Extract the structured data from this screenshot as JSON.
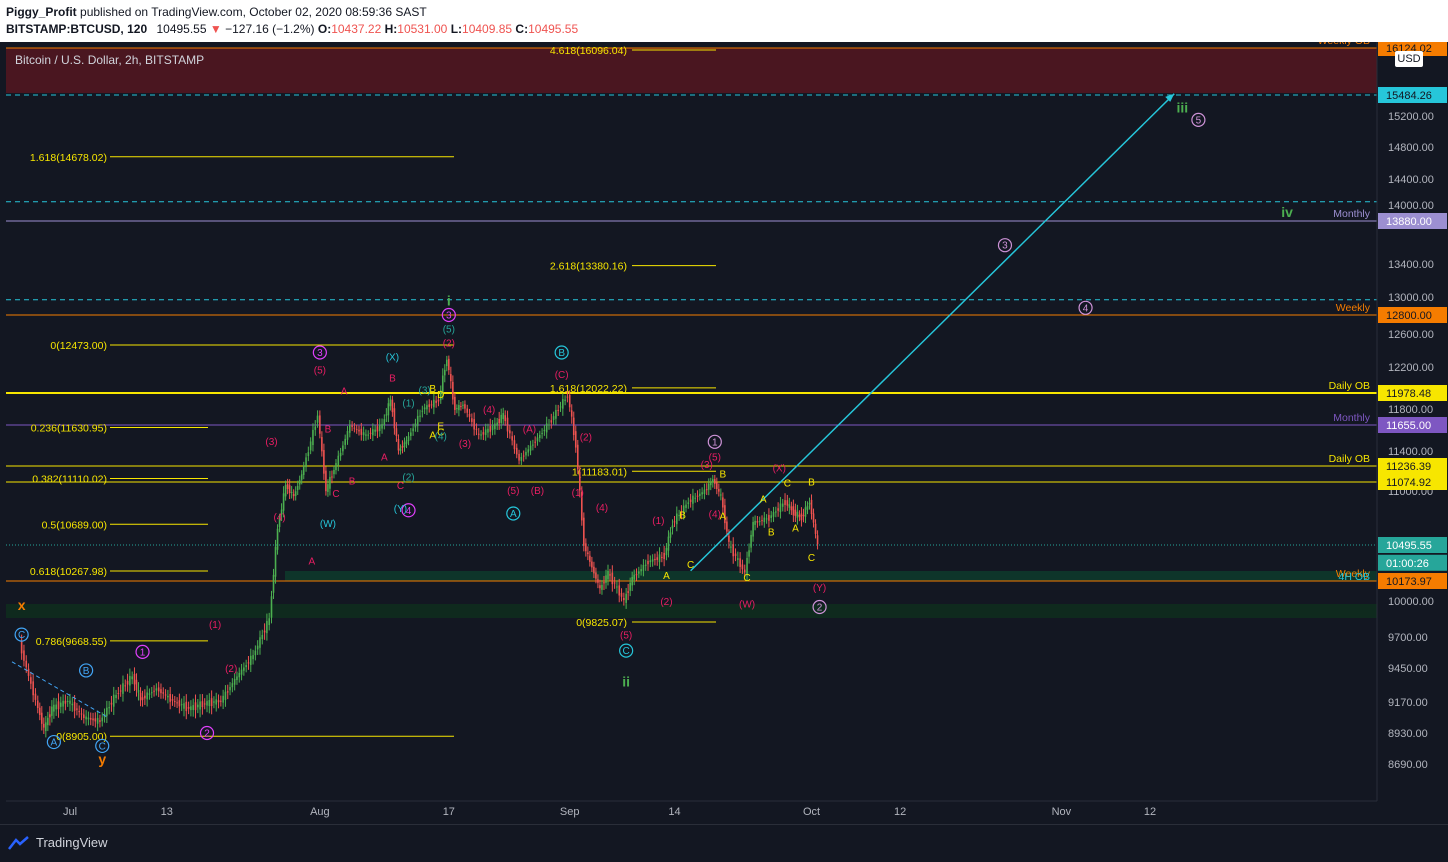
{
  "header": {
    "author": "Piggy_Profit",
    "published_text": "published on TradingView.com, October 02, 2020 08:59:36 SAST",
    "symbol": "BITSTAMP:BTCUSD, 120",
    "last": "10495.55",
    "change": "−127.16 (−1.2%)",
    "o_label": "O:",
    "o": "10437.22",
    "h_label": "H:",
    "h": "10531.00",
    "l_label": "L:",
    "l": "10409.85",
    "c_label": "C:",
    "c": "10495.55"
  },
  "chart_title": "Bitcoin / U.S. Dollar, 2h, BITSTAMP",
  "currency_badge": "USD",
  "footer": {
    "brand": "TradingView"
  },
  "colors": {
    "background": "#131722",
    "fib_yellow": "#f7e600",
    "cyan": "#26c6da",
    "orange": "#f57c00",
    "purple": "#7e57c2",
    "magenta": "#e91e63",
    "green": "#4caf50",
    "lavender": "#ce93d8",
    "price_up": "#26a69a",
    "price_down": "#ef5350"
  },
  "chart_data": {
    "type": "candlestick",
    "symbol": "BITSTAMP:BTCUSD",
    "interval": "2h",
    "ylim": [
      8500,
      16200
    ],
    "y_ticks": [
      15200,
      14800,
      14400,
      14000,
      13400,
      13000,
      12600,
      12200,
      11800,
      11400,
      11000,
      10000,
      9700,
      9450,
      9170,
      8930,
      8690
    ],
    "y_tick_labels": [
      "15200.00",
      "14800.00",
      "14400.00",
      "14000.00",
      "13400.00",
      "13000.00",
      "12600.00",
      "12200.00",
      "11800.00",
      "11400.00",
      "11000.00",
      "10000.00",
      "9700.00",
      "9450.00",
      "9170.00",
      "8930.00",
      "8690.00"
    ],
    "x_tick_labels": [
      "Jul",
      "13",
      "Aug",
      "17",
      "Sep",
      "14",
      "Oct",
      "12",
      "Nov",
      "12"
    ],
    "x_tick_dates": [
      "2020-07-01",
      "2020-07-13",
      "2020-08-01",
      "2020-08-17",
      "2020-09-01",
      "2020-09-14",
      "2020-10-01",
      "2020-10-12",
      "2020-11-01",
      "2020-11-12"
    ],
    "price_path": [
      [
        "2020-06-25",
        9650
      ],
      [
        "2020-06-27",
        9180
      ],
      [
        "2020-06-28",
        8960
      ],
      [
        "2020-06-29",
        9120
      ],
      [
        "2020-07-01",
        9180
      ],
      [
        "2020-07-03",
        9050
      ],
      [
        "2020-07-05",
        9020
      ],
      [
        "2020-07-07",
        9230
      ],
      [
        "2020-07-09",
        9380
      ],
      [
        "2020-07-10",
        9190
      ],
      [
        "2020-07-12",
        9280
      ],
      [
        "2020-07-14",
        9180
      ],
      [
        "2020-07-16",
        9120
      ],
      [
        "2020-07-18",
        9160
      ],
      [
        "2020-07-20",
        9180
      ],
      [
        "2020-07-22",
        9380
      ],
      [
        "2020-07-24",
        9550
      ],
      [
        "2020-07-26",
        9850
      ],
      [
        "2020-07-27",
        10650
      ],
      [
        "2020-07-28",
        11050
      ],
      [
        "2020-07-29",
        10950
      ],
      [
        "2020-07-30",
        11150
      ],
      [
        "2020-08-01",
        11750
      ],
      [
        "2020-08-02",
        11000
      ],
      [
        "2020-08-03",
        11200
      ],
      [
        "2020-08-05",
        11650
      ],
      [
        "2020-08-07",
        11550
      ],
      [
        "2020-08-09",
        11650
      ],
      [
        "2020-08-10",
        11900
      ],
      [
        "2020-08-11",
        11400
      ],
      [
        "2020-08-12",
        11500
      ],
      [
        "2020-08-14",
        11800
      ],
      [
        "2020-08-16",
        11900
      ],
      [
        "2020-08-17",
        12300
      ],
      [
        "2020-08-18",
        11800
      ],
      [
        "2020-08-19",
        11850
      ],
      [
        "2020-08-21",
        11550
      ],
      [
        "2020-08-23",
        11650
      ],
      [
        "2020-08-24",
        11750
      ],
      [
        "2020-08-26",
        11300
      ],
      [
        "2020-08-28",
        11500
      ],
      [
        "2020-08-30",
        11700
      ],
      [
        "2020-09-01",
        11950
      ],
      [
        "2020-09-02",
        11450
      ],
      [
        "2020-09-03",
        10500
      ],
      [
        "2020-09-04",
        10300
      ],
      [
        "2020-09-05",
        10100
      ],
      [
        "2020-09-06",
        10250
      ],
      [
        "2020-09-08",
        10000
      ],
      [
        "2020-09-09",
        10200
      ],
      [
        "2020-09-11",
        10350
      ],
      [
        "2020-09-13",
        10400
      ],
      [
        "2020-09-14",
        10700
      ],
      [
        "2020-09-16",
        10900
      ],
      [
        "2020-09-18",
        11000
      ],
      [
        "2020-09-19",
        11100
      ],
      [
        "2020-09-20",
        10950
      ],
      [
        "2020-09-21",
        10500
      ],
      [
        "2020-09-23",
        10250
      ],
      [
        "2020-09-24",
        10700
      ],
      [
        "2020-09-26",
        10750
      ],
      [
        "2020-09-28",
        10900
      ],
      [
        "2020-09-29",
        10800
      ],
      [
        "2020-09-30",
        10750
      ],
      [
        "2020-10-01",
        10900
      ],
      [
        "2020-10-02",
        10495
      ]
    ],
    "horizontal_levels": [
      {
        "price": 16124.02,
        "label": "Weekly OB",
        "color": "#f57c00"
      },
      {
        "price": 15484.26,
        "label": "",
        "color": "#26c6da"
      },
      {
        "price": 13880.0,
        "label": "Monthly",
        "color": "#9c8fd1"
      },
      {
        "price": 12800.0,
        "label": "Weekly",
        "color": "#f57c00"
      },
      {
        "price": 11978.48,
        "label": "Daily OB",
        "color": "#f7e600"
      },
      {
        "price": 11655.0,
        "label": "Monthly",
        "color": "#7e57c2"
      },
      {
        "price": 11236.39,
        "label": "Daily OB",
        "color": "#f7e600"
      },
      {
        "price": 11074.92,
        "label": "",
        "color": "#f7e600"
      },
      {
        "price": 10495.55,
        "label": "",
        "color": "#26a69a"
      },
      {
        "price": 10173.97,
        "label": "Weekly",
        "color": "#f57c00"
      }
    ],
    "price_axis_badges": [
      {
        "text": "16124.02",
        "price": 16124.02,
        "bg": "#f57c00",
        "fg": "#131722"
      },
      {
        "text": "15484.26",
        "price": 15484.26,
        "bg": "#26c6da",
        "fg": "#131722"
      },
      {
        "text": "13880.00",
        "price": 13880.0,
        "bg": "#9c8fd1",
        "fg": "#ffffff"
      },
      {
        "text": "12800.00",
        "price": 12800.0,
        "bg": "#f57c00",
        "fg": "#131722"
      },
      {
        "text": "11978.48",
        "price": 11978.48,
        "bg": "#f7e600",
        "fg": "#131722"
      },
      {
        "text": "11655.00",
        "price": 11655.0,
        "bg": "#7e57c2",
        "fg": "#ffffff"
      },
      {
        "text": "11236.39",
        "price": 11236.39,
        "bg": "#f7e600",
        "fg": "#131722"
      },
      {
        "text": "11074.92",
        "price": 11074.92,
        "bg": "#f7e600",
        "fg": "#131722"
      },
      {
        "text": "10495.55",
        "price": 10495.55,
        "bg": "#26a69a",
        "fg": "#ffffff"
      },
      {
        "text": "01:00:26",
        "price": 10340,
        "bg": "#26a69a",
        "fg": "#ffffff"
      },
      {
        "text": "10173.97",
        "price": 10173.97,
        "bg": "#f57c00",
        "fg": "#131722"
      }
    ],
    "extra_level_labels": [
      {
        "text": "4H OB",
        "price": 10200,
        "color": "#26c6da"
      }
    ],
    "fib_left": [
      {
        "label": "1.618(14678.02)",
        "price": 14678.02
      },
      {
        "label": "0(12473.00)",
        "price": 12473.0
      },
      {
        "label": "0.236(11630.95)",
        "price": 11630.95
      },
      {
        "label": "0.382(11110.02)",
        "price": 11110.02
      },
      {
        "label": "0.5(10689.00)",
        "price": 10689.0
      },
      {
        "label": "0.618(10267.98)",
        "price": 10267.98
      },
      {
        "label": "0.786(9668.55)",
        "price": 9668.55
      },
      {
        "label": "0(8905.00)",
        "price": 8905.0
      }
    ],
    "fib_right": [
      {
        "label": "4.618(16096.04)",
        "price": 16096.04
      },
      {
        "label": "2.618(13380.16)",
        "price": 13380.16
      },
      {
        "label": "1.618(12022.22)",
        "price": 12022.22
      },
      {
        "label": "1(11183.01)",
        "price": 11183.01
      },
      {
        "label": "0(9825.07)",
        "price": 9825.07
      }
    ],
    "projection": {
      "from": [
        "2020-09-16",
        10270
      ],
      "to": [
        "2020-11-15",
        15500
      ]
    },
    "wave_labels": [
      {
        "text": "i",
        "date": "2020-08-17",
        "price": 12950,
        "color": "#4caf50"
      },
      {
        "text": "ii",
        "date": "2020-09-08",
        "price": 9330,
        "color": "#4caf50"
      },
      {
        "text": "iii",
        "date": "2020-11-16",
        "price": 15300,
        "color": "#4caf50"
      },
      {
        "text": "iv",
        "date": "2020-11-29",
        "price": 13940,
        "color": "#4caf50"
      },
      {
        "text": "x",
        "date": "2020-06-25",
        "price": 9960,
        "color": "#f57c00"
      },
      {
        "text": "y",
        "date": "2020-07-05",
        "price": 8720,
        "color": "#f57c00"
      },
      {
        "text": "1",
        "date": "2020-09-19",
        "price": 11490,
        "color": "#ce93d8",
        "circled": true
      },
      {
        "text": "2",
        "date": "2020-10-02",
        "price": 9950,
        "color": "#ce93d8",
        "circled": true
      },
      {
        "text": "3",
        "date": "2020-10-25",
        "price": 13610,
        "color": "#ce93d8",
        "circled": true
      },
      {
        "text": "4",
        "date": "2020-11-04",
        "price": 12880,
        "color": "#ce93d8",
        "circled": true
      },
      {
        "text": "5",
        "date": "2020-11-18",
        "price": 15150,
        "color": "#ce93d8",
        "circled": true
      },
      {
        "text": "1",
        "date": "2020-07-10",
        "price": 9580,
        "color": "#e040fb",
        "circled": true
      },
      {
        "text": "2",
        "date": "2020-07-18",
        "price": 8930,
        "color": "#e040fb",
        "circled": true
      },
      {
        "text": "3",
        "date": "2020-08-01",
        "price": 12380,
        "color": "#e040fb",
        "circled": true
      },
      {
        "text": "4",
        "date": "2020-08-12",
        "price": 10820,
        "color": "#e040fb",
        "circled": true
      },
      {
        "text": "3",
        "date": "2020-08-17",
        "price": 12800,
        "color": "#e040fb",
        "circled": true
      },
      {
        "text": "A",
        "date": "2020-08-25",
        "price": 10790,
        "color": "#26c6da",
        "circled": true
      },
      {
        "text": "B",
        "date": "2020-08-31",
        "price": 12380,
        "color": "#26c6da",
        "circled": true
      },
      {
        "text": "C",
        "date": "2020-09-08",
        "price": 9590,
        "color": "#26c6da",
        "circled": true
      },
      {
        "text": "A",
        "date": "2020-06-29",
        "price": 8860,
        "color": "#42a5f5",
        "circled": true
      },
      {
        "text": "B",
        "date": "2020-07-03",
        "price": 9430,
        "color": "#42a5f5",
        "circled": true
      },
      {
        "text": "C",
        "date": "2020-07-05",
        "price": 8830,
        "color": "#42a5f5",
        "circled": true
      },
      {
        "text": "C",
        "date": "2020-06-25",
        "price": 9720,
        "color": "#42a5f5",
        "circled": true
      },
      {
        "text": "(W)",
        "date": "2020-08-02",
        "price": 10700,
        "color": "#26c6da"
      },
      {
        "text": "(X)",
        "date": "2020-08-10",
        "price": 12330,
        "color": "#26c6da"
      },
      {
        "text": "(Y)",
        "date": "2020-08-11",
        "price": 10840,
        "color": "#26c6da"
      },
      {
        "text": "(W)",
        "date": "2020-09-23",
        "price": 9980,
        "color": "#e91e63"
      },
      {
        "text": "(X)",
        "date": "2020-09-27",
        "price": 11220,
        "color": "#e91e63"
      },
      {
        "text": "(Y)",
        "date": "2020-10-02",
        "price": 10120,
        "color": "#e91e63"
      },
      {
        "text": "(1)",
        "date": "2020-07-19",
        "price": 9810,
        "color": "#e91e63"
      },
      {
        "text": "(2)",
        "date": "2020-07-21",
        "price": 9450,
        "color": "#e91e63"
      },
      {
        "text": "(3)",
        "date": "2020-07-26",
        "price": 11500,
        "color": "#e91e63"
      },
      {
        "text": "(4)",
        "date": "2020-07-27",
        "price": 10760,
        "color": "#e91e63"
      },
      {
        "text": "(5)",
        "date": "2020-08-01",
        "price": 12180,
        "color": "#e91e63"
      },
      {
        "text": "(5)",
        "date": "2020-08-17",
        "price": 12660,
        "color": "#26a69a"
      },
      {
        "text": "(2)",
        "date": "2020-08-17",
        "price": 12500,
        "color": "#e91e63"
      },
      {
        "text": "(3)",
        "date": "2020-08-19",
        "price": 11480,
        "color": "#e91e63"
      },
      {
        "text": "(4)",
        "date": "2020-08-22",
        "price": 11800,
        "color": "#e91e63"
      },
      {
        "text": "(5)",
        "date": "2020-08-25",
        "price": 11010,
        "color": "#e91e63"
      },
      {
        "text": "(A)",
        "date": "2020-08-27",
        "price": 11620,
        "color": "#e91e63"
      },
      {
        "text": "(B)",
        "date": "2020-08-28",
        "price": 11010,
        "color": "#e91e63"
      },
      {
        "text": "(C)",
        "date": "2020-08-31",
        "price": 12140,
        "color": "#e91e63"
      },
      {
        "text": "(1)",
        "date": "2020-09-02",
        "price": 10990,
        "color": "#e91e63"
      },
      {
        "text": "(2)",
        "date": "2020-09-03",
        "price": 11540,
        "color": "#e91e63"
      },
      {
        "text": "(4)",
        "date": "2020-09-05",
        "price": 10850,
        "color": "#e91e63"
      },
      {
        "text": "(5)",
        "date": "2020-09-08",
        "price": 9720,
        "color": "#e91e63"
      },
      {
        "text": "(1)",
        "date": "2020-09-12",
        "price": 10730,
        "color": "#e91e63"
      },
      {
        "text": "(2)",
        "date": "2020-09-13",
        "price": 10000,
        "color": "#e91e63"
      },
      {
        "text": "(3)",
        "date": "2020-09-18",
        "price": 11260,
        "color": "#e91e63"
      },
      {
        "text": "(4)",
        "date": "2020-09-19",
        "price": 10790,
        "color": "#e91e63"
      },
      {
        "text": "(5)",
        "date": "2020-09-19",
        "price": 11340,
        "color": "#e91e63"
      },
      {
        "text": "A",
        "date": "2020-07-31",
        "price": 10360,
        "color": "#e91e63"
      },
      {
        "text": "B",
        "date": "2020-08-02",
        "price": 11620,
        "color": "#e91e63"
      },
      {
        "text": "C",
        "date": "2020-08-03",
        "price": 10980,
        "color": "#e91e63"
      },
      {
        "text": "A",
        "date": "2020-08-04",
        "price": 12000,
        "color": "#e91e63"
      },
      {
        "text": "B",
        "date": "2020-08-05",
        "price": 11090,
        "color": "#e91e63"
      },
      {
        "text": "A",
        "date": "2020-08-09",
        "price": 11340,
        "color": "#e91e63"
      },
      {
        "text": "B",
        "date": "2020-08-10",
        "price": 12110,
        "color": "#e91e63"
      },
      {
        "text": "C",
        "date": "2020-08-11",
        "price": 11050,
        "color": "#e91e63"
      },
      {
        "text": "A",
        "date": "2020-09-13",
        "price": 10230,
        "color": "#f7e600"
      },
      {
        "text": "B",
        "date": "2020-09-15",
        "price": 10780,
        "color": "#f7e600"
      },
      {
        "text": "C",
        "date": "2020-09-16",
        "price": 10330,
        "color": "#f7e600"
      },
      {
        "text": "A",
        "date": "2020-09-20",
        "price": 10770,
        "color": "#f7e600"
      },
      {
        "text": "B",
        "date": "2020-09-20",
        "price": 11160,
        "color": "#f7e600"
      },
      {
        "text": "C",
        "date": "2020-09-23",
        "price": 10210,
        "color": "#f7e600"
      },
      {
        "text": "A",
        "date": "2020-09-25",
        "price": 10930,
        "color": "#f7e600"
      },
      {
        "text": "B",
        "date": "2020-09-26",
        "price": 10620,
        "color": "#f7e600"
      },
      {
        "text": "C",
        "date": "2020-09-28",
        "price": 11070,
        "color": "#f7e600"
      },
      {
        "text": "A",
        "date": "2020-09-29",
        "price": 10660,
        "color": "#f7e600"
      },
      {
        "text": "B",
        "date": "2020-10-01",
        "price": 11080,
        "color": "#f7e600"
      },
      {
        "text": "C",
        "date": "2020-10-01",
        "price": 10390,
        "color": "#f7e600"
      },
      {
        "text": "A",
        "date": "2020-08-15",
        "price": 11560,
        "color": "#f7e600"
      },
      {
        "text": "C",
        "date": "2020-08-16",
        "price": 11590,
        "color": "#f7e600"
      },
      {
        "text": "E",
        "date": "2020-08-16",
        "price": 11650,
        "color": "#f7e600"
      },
      {
        "text": "D",
        "date": "2020-08-16",
        "price": 11970,
        "color": "#f7e600"
      },
      {
        "text": "B",
        "date": "2020-08-15",
        "price": 12020,
        "color": "#f7e600"
      },
      {
        "text": "(1)",
        "date": "2020-08-12",
        "price": 11870,
        "color": "#26a69a"
      },
      {
        "text": "(2)",
        "date": "2020-08-12",
        "price": 11130,
        "color": "#26a69a"
      },
      {
        "text": "(3)",
        "date": "2020-08-14",
        "price": 12010,
        "color": "#26a69a"
      },
      {
        "text": "(4)",
        "date": "2020-08-16",
        "price": 11550,
        "color": "#26a69a"
      }
    ]
  }
}
